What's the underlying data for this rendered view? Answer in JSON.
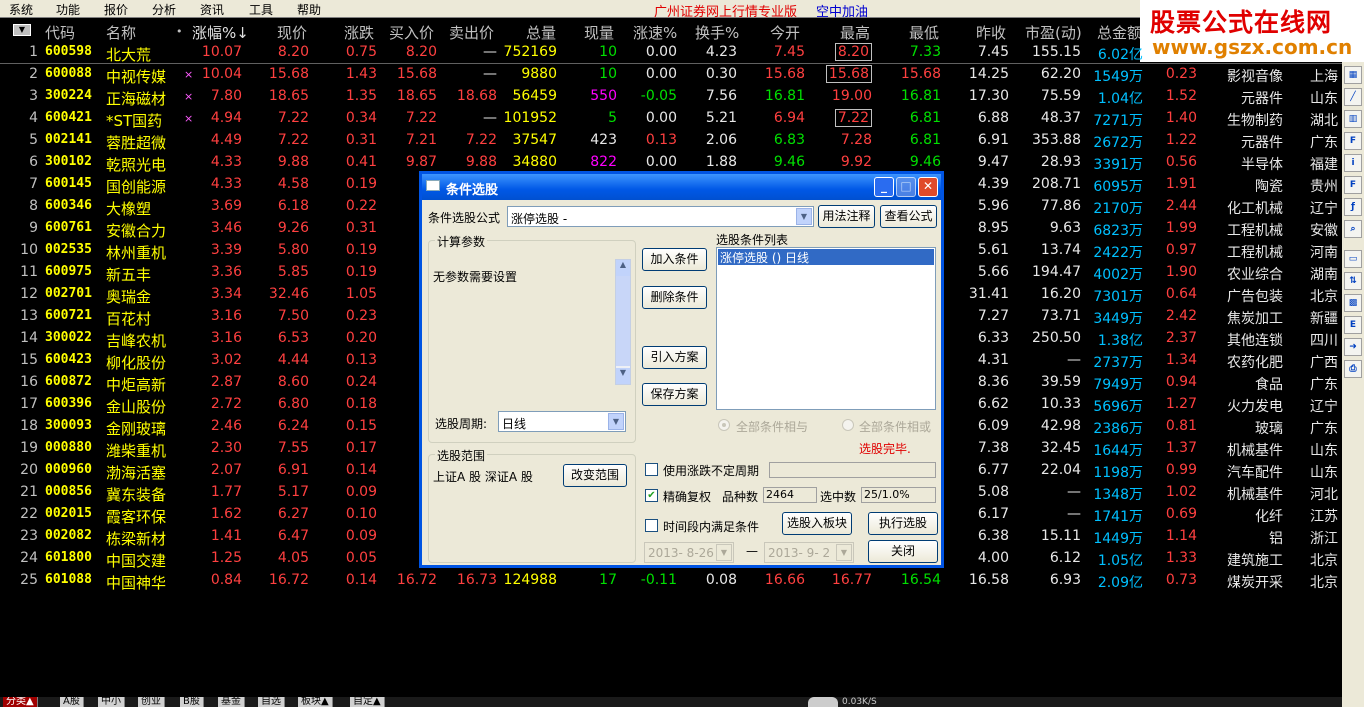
{
  "menu": [
    "系统",
    "功能",
    "报价",
    "分析",
    "资讯",
    "工具",
    "帮助"
  ],
  "menu_title": "广州证券网上行情专业版",
  "menu_link": "空中加油",
  "logo": {
    "line1": "股票公式在线网",
    "line2": "www.gszx.com.cn"
  },
  "columns": [
    "代码",
    "名称",
    "•",
    "涨幅%↓",
    "现价",
    "涨跌",
    "买入价",
    "卖出价",
    "总量",
    "现量",
    "涨速%",
    "换手%",
    "今开",
    "最高",
    "最低",
    "昨收",
    "市盈(动)",
    "总金额"
  ],
  "rows": [
    {
      "no": "1",
      "code": "600598",
      "name": "北大荒",
      "mark": "",
      "pct": "10.07",
      "price": "8.20",
      "chg": "0.75",
      "bid": "8.20",
      "ask": "—",
      "vol": "752169",
      "cur": "10",
      "speed": "0.00",
      "turn": "4.23",
      "open": "7.45",
      "high": "8.20",
      "low": "7.33",
      "prev": "7.45",
      "pe": "155.15",
      "amt": "6.02亿",
      "x1": "",
      "ind": "",
      "reg": ""
    },
    {
      "no": "2",
      "code": "600088",
      "name": "中视传媒",
      "mark": "×",
      "pct": "10.04",
      "price": "15.68",
      "chg": "1.43",
      "bid": "15.68",
      "ask": "—",
      "vol": "9880",
      "cur": "10",
      "speed": "0.00",
      "turn": "0.30",
      "open": "15.68",
      "high": "15.68",
      "low": "15.68",
      "prev": "14.25",
      "pe": "62.20",
      "amt": "1549万",
      "x1": "0.23",
      "ind": "影视音像",
      "reg": "上海"
    },
    {
      "no": "3",
      "code": "300224",
      "name": "正海磁材",
      "mark": "×",
      "pct": "7.80",
      "price": "18.65",
      "chg": "1.35",
      "bid": "18.65",
      "ask": "18.68",
      "vol": "56459",
      "cur": "550",
      "speed": "-0.05",
      "turn": "7.56",
      "open": "16.81",
      "high": "19.00",
      "low": "16.81",
      "prev": "17.30",
      "pe": "75.59",
      "amt": "1.04亿",
      "x1": "1.52",
      "ind": "元器件",
      "reg": "山东"
    },
    {
      "no": "4",
      "code": "600421",
      "name": "*ST国药",
      "mark": "×",
      "pct": "4.94",
      "price": "7.22",
      "chg": "0.34",
      "bid": "7.22",
      "ask": "—",
      "vol": "101952",
      "cur": "5",
      "speed": "0.00",
      "turn": "5.21",
      "open": "6.94",
      "high": "7.22",
      "low": "6.81",
      "prev": "6.88",
      "pe": "48.37",
      "amt": "7271万",
      "x1": "1.40",
      "ind": "生物制药",
      "reg": "湖北"
    },
    {
      "no": "5",
      "code": "002141",
      "name": "蓉胜超微",
      "mark": "",
      "pct": "4.49",
      "price": "7.22",
      "chg": "0.31",
      "bid": "7.21",
      "ask": "7.22",
      "vol": "37547",
      "cur": "423",
      "speed": "0.13",
      "turn": "2.06",
      "open": "6.83",
      "high": "7.28",
      "low": "6.81",
      "prev": "6.91",
      "pe": "353.88",
      "amt": "2672万",
      "x1": "1.22",
      "ind": "元器件",
      "reg": "广东"
    },
    {
      "no": "6",
      "code": "300102",
      "name": "乾照光电",
      "mark": "",
      "pct": "4.33",
      "price": "9.88",
      "chg": "0.41",
      "bid": "9.87",
      "ask": "9.88",
      "vol": "34880",
      "cur": "822",
      "speed": "0.00",
      "turn": "1.88",
      "open": "9.46",
      "high": "9.92",
      "low": "9.46",
      "prev": "9.47",
      "pe": "28.93",
      "amt": "3391万",
      "x1": "0.56",
      "ind": "半导体",
      "reg": "福建"
    },
    {
      "no": "7",
      "code": "600145",
      "name": "国创能源",
      "mark": "",
      "pct": "4.33",
      "price": "4.58",
      "chg": "0.19",
      "bid": "4",
      "ask": "",
      "vol": "",
      "cur": "",
      "speed": "",
      "turn": "",
      "open": "",
      "high": "",
      "low": "",
      "prev": "4.39",
      "pe": "208.71",
      "amt": "6095万",
      "x1": "1.91",
      "ind": "陶瓷",
      "reg": "贵州"
    },
    {
      "no": "8",
      "code": "600346",
      "name": "大橡塑",
      "mark": "",
      "pct": "3.69",
      "price": "6.18",
      "chg": "0.22",
      "bid": "6",
      "ask": "",
      "vol": "",
      "cur": "",
      "speed": "",
      "turn": "",
      "open": "",
      "high": "",
      "low": "",
      "prev": "5.96",
      "pe": "77.86",
      "amt": "2170万",
      "x1": "2.44",
      "ind": "化工机械",
      "reg": "辽宁"
    },
    {
      "no": "9",
      "code": "600761",
      "name": "安徽合力",
      "mark": "",
      "pct": "3.46",
      "price": "9.26",
      "chg": "0.31",
      "bid": "9",
      "ask": "",
      "vol": "",
      "cur": "",
      "speed": "",
      "turn": "",
      "open": "",
      "high": "",
      "low": "",
      "prev": "8.95",
      "pe": "9.63",
      "amt": "6823万",
      "x1": "1.99",
      "ind": "工程机械",
      "reg": "安徽"
    },
    {
      "no": "10",
      "code": "002535",
      "name": "林州重机",
      "mark": "",
      "pct": "3.39",
      "price": "5.80",
      "chg": "0.19",
      "bid": "5",
      "ask": "",
      "vol": "",
      "cur": "",
      "speed": "",
      "turn": "",
      "open": "",
      "high": "",
      "low": "",
      "prev": "5.61",
      "pe": "13.74",
      "amt": "2422万",
      "x1": "0.97",
      "ind": "工程机械",
      "reg": "河南"
    },
    {
      "no": "11",
      "code": "600975",
      "name": "新五丰",
      "mark": "",
      "pct": "3.36",
      "price": "5.85",
      "chg": "0.19",
      "bid": "5",
      "ask": "",
      "vol": "",
      "cur": "",
      "speed": "",
      "turn": "",
      "open": "",
      "high": "",
      "low": "",
      "prev": "5.66",
      "pe": "194.47",
      "amt": "4002万",
      "x1": "1.90",
      "ind": "农业综合",
      "reg": "湖南"
    },
    {
      "no": "12",
      "code": "002701",
      "name": "奥瑞金",
      "mark": "",
      "pct": "3.34",
      "price": "32.46",
      "chg": "1.05",
      "bid": "32",
      "ask": "",
      "vol": "",
      "cur": "",
      "speed": "",
      "turn": "",
      "open": "",
      "high": "",
      "low": "",
      "prev": "31.41",
      "pe": "16.20",
      "amt": "7301万",
      "x1": "0.64",
      "ind": "广告包装",
      "reg": "北京"
    },
    {
      "no": "13",
      "code": "600721",
      "name": "百花村",
      "mark": "",
      "pct": "3.16",
      "price": "7.50",
      "chg": "0.23",
      "bid": "7",
      "ask": "",
      "vol": "",
      "cur": "",
      "speed": "",
      "turn": "",
      "open": "",
      "high": "",
      "low": "",
      "prev": "7.27",
      "pe": "73.71",
      "amt": "3449万",
      "x1": "2.42",
      "ind": "焦炭加工",
      "reg": "新疆"
    },
    {
      "no": "14",
      "code": "300022",
      "name": "吉峰农机",
      "mark": "",
      "pct": "3.16",
      "price": "6.53",
      "chg": "0.20",
      "bid": "6",
      "ask": "",
      "vol": "",
      "cur": "",
      "speed": "",
      "turn": "",
      "open": "",
      "high": "",
      "low": "",
      "prev": "6.33",
      "pe": "250.50",
      "amt": "1.38亿",
      "x1": "2.37",
      "ind": "其他连锁",
      "reg": "四川"
    },
    {
      "no": "15",
      "code": "600423",
      "name": "柳化股份",
      "mark": "",
      "pct": "3.02",
      "price": "4.44",
      "chg": "0.13",
      "bid": "4",
      "ask": "",
      "vol": "",
      "cur": "",
      "speed": "",
      "turn": "",
      "open": "",
      "high": "",
      "low": "",
      "prev": "4.31",
      "pe": "—",
      "amt": "2737万",
      "x1": "1.34",
      "ind": "农药化肥",
      "reg": "广西"
    },
    {
      "no": "16",
      "code": "600872",
      "name": "中炬高新",
      "mark": "",
      "pct": "2.87",
      "price": "8.60",
      "chg": "0.24",
      "bid": "8",
      "ask": "",
      "vol": "",
      "cur": "",
      "speed": "",
      "turn": "",
      "open": "",
      "high": "",
      "low": "",
      "prev": "8.36",
      "pe": "39.59",
      "amt": "7949万",
      "x1": "0.94",
      "ind": "食品",
      "reg": "广东"
    },
    {
      "no": "17",
      "code": "600396",
      "name": "金山股份",
      "mark": "",
      "pct": "2.72",
      "price": "6.80",
      "chg": "0.18",
      "bid": "6",
      "ask": "",
      "vol": "",
      "cur": "",
      "speed": "",
      "turn": "",
      "open": "",
      "high": "",
      "low": "",
      "prev": "6.62",
      "pe": "10.33",
      "amt": "5696万",
      "x1": "1.27",
      "ind": "火力发电",
      "reg": "辽宁"
    },
    {
      "no": "18",
      "code": "300093",
      "name": "金刚玻璃",
      "mark": "",
      "pct": "2.46",
      "price": "6.24",
      "chg": "0.15",
      "bid": "6",
      "ask": "",
      "vol": "",
      "cur": "",
      "speed": "",
      "turn": "",
      "open": "",
      "high": "",
      "low": "",
      "prev": "6.09",
      "pe": "42.98",
      "amt": "2386万",
      "x1": "0.81",
      "ind": "玻璃",
      "reg": "广东"
    },
    {
      "no": "19",
      "code": "000880",
      "name": "潍柴重机",
      "mark": "",
      "pct": "2.30",
      "price": "7.55",
      "chg": "0.17",
      "bid": "7",
      "ask": "",
      "vol": "",
      "cur": "",
      "speed": "",
      "turn": "",
      "open": "",
      "high": "",
      "low": "",
      "prev": "7.38",
      "pe": "32.45",
      "amt": "1644万",
      "x1": "1.37",
      "ind": "机械基件",
      "reg": "山东"
    },
    {
      "no": "20",
      "code": "000960",
      "name": "渤海活塞",
      "mark": "",
      "pct": "2.07",
      "price": "6.91",
      "chg": "0.14",
      "bid": "6",
      "ask": "",
      "vol": "",
      "cur": "",
      "speed": "",
      "turn": "",
      "open": "",
      "high": "",
      "low": "",
      "prev": "6.77",
      "pe": "22.04",
      "amt": "1198万",
      "x1": "0.99",
      "ind": "汽车配件",
      "reg": "山东"
    },
    {
      "no": "21",
      "code": "000856",
      "name": "冀东装备",
      "mark": "",
      "pct": "1.77",
      "price": "5.17",
      "chg": "0.09",
      "bid": "5",
      "ask": "",
      "vol": "",
      "cur": "",
      "speed": "",
      "turn": "",
      "open": "",
      "high": "",
      "low": "",
      "prev": "5.08",
      "pe": "—",
      "amt": "1348万",
      "x1": "1.02",
      "ind": "机械基件",
      "reg": "河北"
    },
    {
      "no": "22",
      "code": "002015",
      "name": "霞客环保",
      "mark": "",
      "pct": "1.62",
      "price": "6.27",
      "chg": "0.10",
      "bid": "6",
      "ask": "",
      "vol": "",
      "cur": "",
      "speed": "",
      "turn": "",
      "open": "",
      "high": "",
      "low": "",
      "prev": "6.17",
      "pe": "—",
      "amt": "1741万",
      "x1": "0.69",
      "ind": "化纤",
      "reg": "江苏"
    },
    {
      "no": "23",
      "code": "002082",
      "name": "栋梁新材",
      "mark": "",
      "pct": "1.41",
      "price": "6.47",
      "chg": "0.09",
      "bid": "6",
      "ask": "",
      "vol": "",
      "cur": "",
      "speed": "",
      "turn": "",
      "open": "",
      "high": "",
      "low": "",
      "prev": "6.38",
      "pe": "15.11",
      "amt": "1449万",
      "x1": "1.14",
      "ind": "铝",
      "reg": "浙江"
    },
    {
      "no": "24",
      "code": "601800",
      "name": "中国交建",
      "mark": "",
      "pct": "1.25",
      "price": "4.05",
      "chg": "0.05",
      "bid": "4",
      "ask": "",
      "vol": "",
      "cur": "",
      "speed": "",
      "turn": "",
      "open": "",
      "high": "",
      "low": "",
      "prev": "4.00",
      "pe": "6.12",
      "amt": "1.05亿",
      "x1": "1.33",
      "ind": "建筑施工",
      "reg": "北京"
    },
    {
      "no": "25",
      "code": "601088",
      "name": "中国神华",
      "mark": "",
      "pct": "0.84",
      "price": "16.72",
      "chg": "0.14",
      "bid": "16.72",
      "ask": "16.73",
      "vol": "124988",
      "cur": "17",
      "speed": "-0.11",
      "turn": "0.08",
      "open": "16.66",
      "high": "16.77",
      "low": "16.54",
      "prev": "16.58",
      "pe": "6.93",
      "amt": "2.09亿",
      "x1": "0.73",
      "ind": "煤炭开采",
      "reg": "北京"
    }
  ],
  "tabs": [
    "分类▲",
    "A股",
    "中小",
    "创业",
    "B股",
    "基金",
    "自选",
    "板块▲",
    "自定▲"
  ],
  "status": "0.03K/S",
  "sidebar_icons": [
    "chart-icon",
    "kline-icon",
    "bars-icon",
    "f10-icon",
    "info-icon",
    "f10-icon",
    "fx-icon",
    "search-icon",
    "folder-icon",
    "arrows-icon",
    "grid-icon",
    "etf-icon",
    "export-icon",
    "print-icon"
  ],
  "dialog": {
    "title": "条件选股",
    "formula_label": "条件选股公式",
    "formula_value": "涨停选股 -",
    "usage_btn": "用法注释",
    "view_btn": "查看公式",
    "params_group": "计算参数",
    "params_text": "无参数需要设置",
    "add_btn": "加入条件",
    "delete_btn": "删除条件",
    "import_btn": "引入方案",
    "save_btn": "保存方案",
    "list_label": "选股条件列表",
    "list_items": [
      "涨停选股  ()  日线"
    ],
    "period_label": "选股周期:",
    "period_value": "日线",
    "radio_and": "全部条件相与",
    "radio_or": "全部条件相或",
    "done_text": "选股完毕.",
    "range_group": "选股范围",
    "range_text": "上证A 股  深证A 股",
    "change_range_btn": "改变范围",
    "use_period_label": "使用涨跌不定周期",
    "precise_label": "精确复权",
    "count_label": "品种数",
    "count_value": "2464",
    "hit_label": "选中数",
    "hit_value": "25/1.0%",
    "time_label": "时间段内满足条件",
    "date_from": "2013- 8-26",
    "date_to": "2013- 9- 2",
    "dash": "—",
    "to_block_btn": "选股入板块",
    "run_btn": "执行选股",
    "close_btn": "关闭"
  }
}
